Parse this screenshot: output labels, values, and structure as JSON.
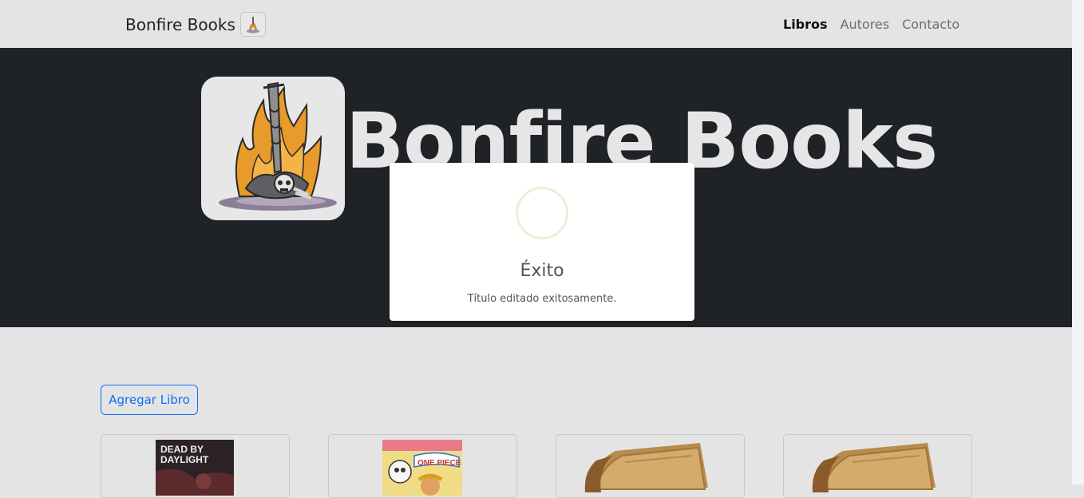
{
  "navbar": {
    "brand": "Bonfire Books",
    "links": [
      {
        "label": "Libros",
        "active": true
      },
      {
        "label": "Autores",
        "active": false
      },
      {
        "label": "Contacto",
        "active": false
      }
    ]
  },
  "hero": {
    "title": "Bonfire Books"
  },
  "modal": {
    "icon": "success-check-icon",
    "title": "Éxito",
    "text": "Título editado exitosamente."
  },
  "actions": {
    "add_book_label": "Agregar Libro"
  },
  "books": [
    {
      "cover": "dead-by-daylight-cover",
      "cover_text": [
        "DEAD BY",
        "DAYLIGHT"
      ]
    },
    {
      "cover": "one-piece-cover",
      "cover_text": [
        "ONE PIECE"
      ]
    },
    {
      "cover": "placeholder-book-cover"
    },
    {
      "cover": "placeholder-book-cover"
    }
  ],
  "colors": {
    "navbar_bg": "#e4e4e4",
    "hero_bg": "#1f2226",
    "primary": "#0d6efd",
    "success_ring": "#e3f3d9"
  }
}
